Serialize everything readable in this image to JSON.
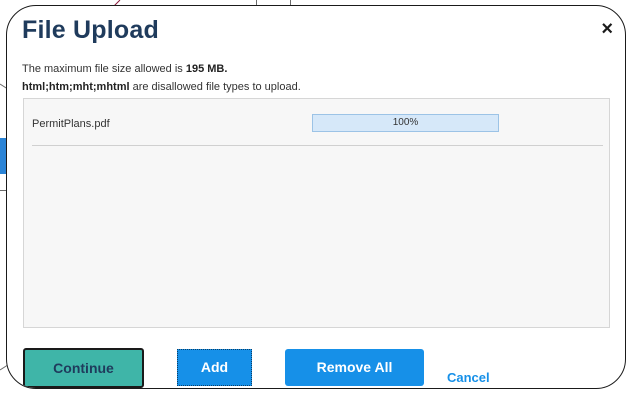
{
  "dialog": {
    "title": "File Upload",
    "close_symbol": "×",
    "info_line1_prefix": "The maximum file size allowed is ",
    "info_line1_size": "195 MB.",
    "info_line2_types": "html;htm;mht;mhtml",
    "info_line2_suffix": " are disallowed file types to upload."
  },
  "files": [
    {
      "name": "PermitPlans.pdf",
      "progress_label": "100%",
      "progress_fraction": 1.0
    }
  ],
  "buttons": {
    "continue": "Continue",
    "add": "Add",
    "remove_all": "Remove All",
    "cancel": "Cancel"
  },
  "colors": {
    "title": "#1f3b5c",
    "primary_button": "#1690e8",
    "continue_button": "#3fb5a8",
    "link": "#1690e8"
  },
  "icons": {
    "close": "close-icon"
  }
}
